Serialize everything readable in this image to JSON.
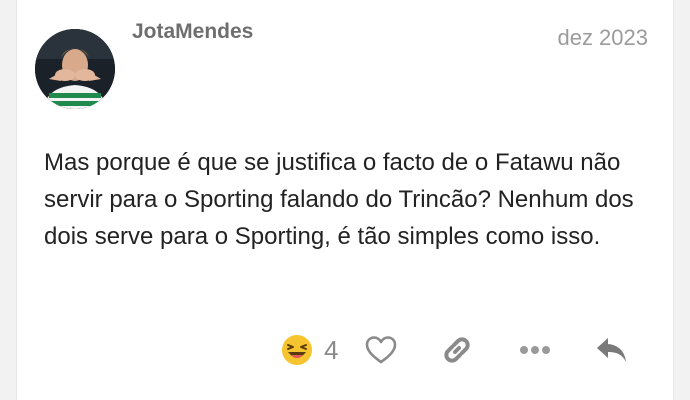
{
  "post": {
    "username": "JotaMendes",
    "date": "dez 2023",
    "body": "Mas porque é que se justifica o facto de o Fatawu não servir para o Sporting falando do Trincão? Nenhum dos dois serve para o Sporting, é tão simples como isso."
  },
  "actions": {
    "reaction_emoji": "laughing-emoji-icon",
    "reaction_count": "4",
    "like_icon": "heart-outline-icon",
    "link_icon": "link-icon",
    "more_icon": "ellipsis-icon",
    "reply_icon": "reply-icon"
  },
  "colors": {
    "text": "#222222",
    "muted": "#9b9b9b",
    "icon": "#8a8a8a",
    "emoji": "#f6c42e"
  }
}
